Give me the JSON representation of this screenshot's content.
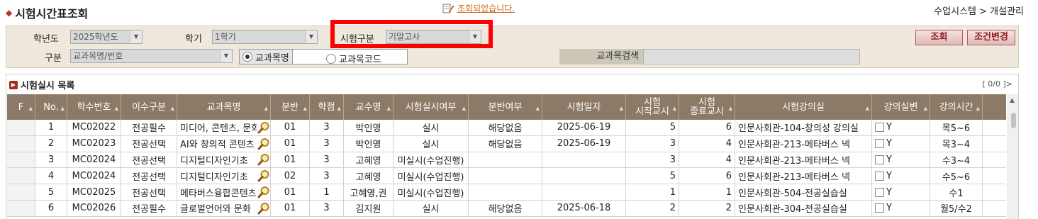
{
  "page": {
    "title": "시험시간표조회",
    "status_message": "조회되었습니다.",
    "breadcrumb": "수업시스템 > 개설관리"
  },
  "search": {
    "year_label": "학년도",
    "year_value": "2025학년도",
    "term_label": "학기",
    "term_value": "1학기",
    "exam_type_label": "시험구분",
    "exam_type_value": "기말고사",
    "category_label": "구분",
    "category_value": "교과목명/번호",
    "radio_course_name": "교과목명",
    "radio_course_code": "교과목코드",
    "keyword_label": "교과목검색",
    "keyword_value": "",
    "search_button": "조회",
    "reset_button": "조건변경"
  },
  "list": {
    "title": "시험실시 목록",
    "count": "[ 0/0 ]>",
    "columns": [
      "F",
      "No.",
      "학수번호",
      "이수구분",
      "교과목명",
      "분반",
      "학점",
      "교수명",
      "시험실시여부",
      "분반여부",
      "시험일자",
      "시험\n시작교시",
      "시험\n종료교시",
      "시험강의실",
      "강의실변",
      "강의시간"
    ],
    "rows": [
      {
        "no": "1",
        "code": "MC02022",
        "type": "전공필수",
        "name": "미디어, 콘텐츠, 문화",
        "section": "01",
        "credit": "3",
        "prof": "박인영",
        "held": "실시",
        "split": "해당없음",
        "date": "2025-06-19",
        "start": "5",
        "end": "6",
        "room": "인문사회관-104-창의성 강의실",
        "room_chk": "Y",
        "time": "목5~6"
      },
      {
        "no": "2",
        "code": "MC02023",
        "type": "전공선택",
        "name": "AI와 창의적 콘텐츠",
        "section": "01",
        "credit": "3",
        "prof": "박인영",
        "held": "실시",
        "split": "해당없음",
        "date": "2025-06-19",
        "start": "3",
        "end": "4",
        "room": "인문사회관-213-메타버스 넥",
        "room_chk": "Y",
        "time": "목3~4"
      },
      {
        "no": "3",
        "code": "MC02024",
        "type": "전공선택",
        "name": "디지털디자인기초",
        "section": "01",
        "credit": "3",
        "prof": "고혜영",
        "held": "미실시(수업진행)",
        "split": "",
        "date": "",
        "start": "3",
        "end": "4",
        "room": "인문사회관-213-메타버스 넥",
        "room_chk": "Y",
        "time": "수3~4"
      },
      {
        "no": "4",
        "code": "MC02024",
        "type": "전공선택",
        "name": "디지털디자인기초",
        "section": "02",
        "credit": "3",
        "prof": "고혜영",
        "held": "미실시(수업진행)",
        "split": "",
        "date": "",
        "start": "5",
        "end": "6",
        "room": "인문사회관-213-메타버스 넥",
        "room_chk": "Y",
        "time": "수5~6"
      },
      {
        "no": "5",
        "code": "MC02025",
        "type": "전공선택",
        "name": "메타버스융합콘텐츠",
        "section": "01",
        "credit": "1",
        "prof": "고혜영,권",
        "held": "미실시(수업진행)",
        "split": "",
        "date": "",
        "start": "1",
        "end": "1",
        "room": "인문사회관-504-전공실습실",
        "room_chk": "Y",
        "time": "수1"
      },
      {
        "no": "6",
        "code": "MC02026",
        "type": "전공필수",
        "name": "글로벌언어와 문화",
        "section": "01",
        "credit": "3",
        "prof": "김지원",
        "held": "실시",
        "split": "해당없음",
        "date": "2025-06-18",
        "start": "2",
        "end": "2",
        "room": "인문사회관-304-전공실습실",
        "room_chk": "Y",
        "time": "월5/수2"
      }
    ]
  },
  "colors": {
    "header_bg": "#8c7a66",
    "panel_bg": "#eee9dc",
    "highlight": "#ff0000",
    "accent": "#a72d22"
  }
}
